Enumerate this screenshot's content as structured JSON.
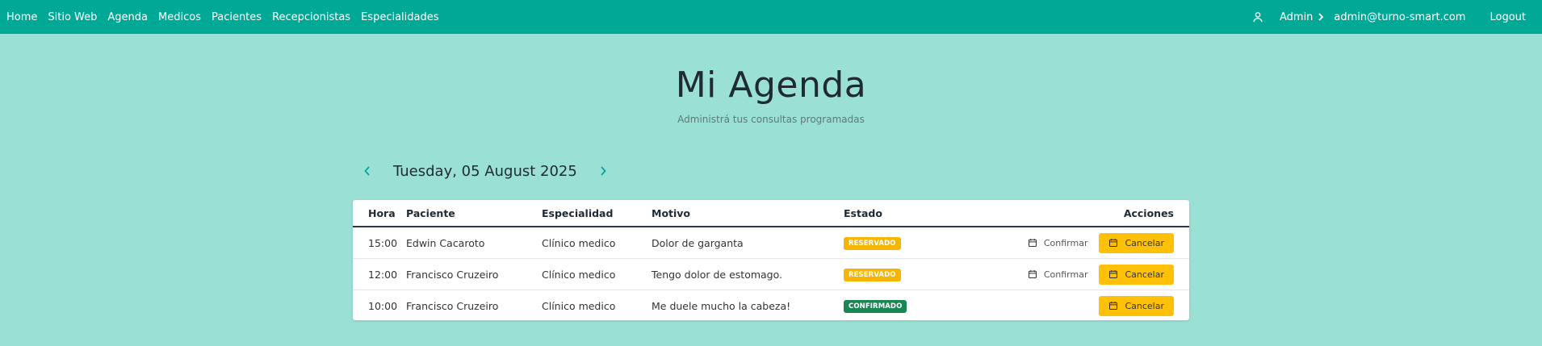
{
  "nav": {
    "links": [
      "Home",
      "Sitio Web",
      "Agenda",
      "Medicos",
      "Pacientes",
      "Recepcionistas",
      "Especialidades"
    ],
    "user_name": "Admin",
    "user_email": "admin@turno-smart.com",
    "logout": "Logout"
  },
  "header": {
    "title": "Mi Agenda",
    "subtitle": "Administrá tus consultas programadas"
  },
  "date": {
    "current": "Tuesday, 05 August 2025"
  },
  "table": {
    "headers": [
      "Hora",
      "Paciente",
      "Especialidad",
      "Motivo",
      "Estado",
      "Acciones"
    ],
    "rows": [
      {
        "hora": "15:00",
        "paciente": "Edwin Cacaroto",
        "especialidad": "Clínico medico",
        "motivo": "Dolor de garganta",
        "estado": "RESERVADO",
        "confirm": "Confirmar",
        "cancel": "Cancelar"
      },
      {
        "hora": "12:00",
        "paciente": "Francisco Cruzeiro",
        "especialidad": "Clínico medico",
        "motivo": "Tengo dolor de estomago.",
        "estado": "RESERVADO",
        "confirm": "Confirmar",
        "cancel": "Cancelar"
      },
      {
        "hora": "10:00",
        "paciente": "Francisco Cruzeiro",
        "especialidad": "Clínico medico",
        "motivo": "Me duele mucho la cabeza!",
        "estado": "CONFIRMADO",
        "cancel": "Cancelar"
      }
    ]
  },
  "colors": {
    "navbar": "#00a896",
    "background": "#9ae0d5",
    "reservado": "#f7b500",
    "confirmado": "#198754",
    "cancel": "#ffc107"
  },
  "icons": [
    "user-icon",
    "chevron-right-icon",
    "chevron-left-icon",
    "calendar-icon"
  ]
}
